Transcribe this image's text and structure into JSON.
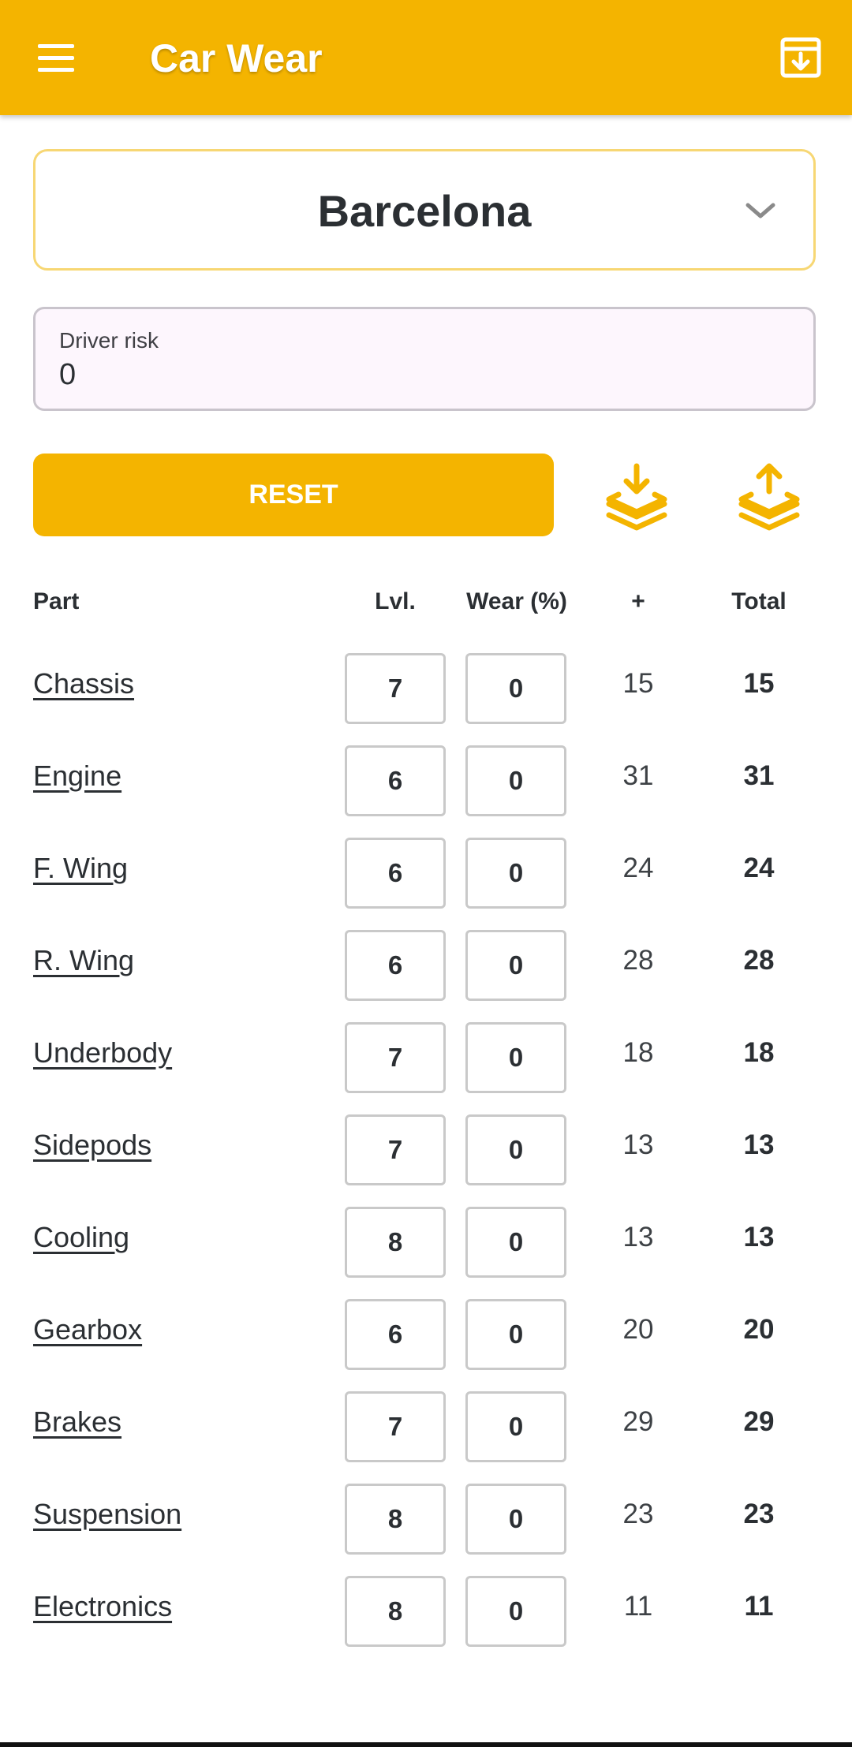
{
  "appbar": {
    "title": "Car Wear",
    "menu_icon": "hamburger-menu-icon",
    "action_icon": "archive-download-icon",
    "color": "#f4b400"
  },
  "track_selector": {
    "value": "Barcelona",
    "icon": "chevron-down-icon"
  },
  "driver_risk": {
    "label": "Driver risk",
    "value": "0"
  },
  "actions": {
    "reset_label": "RESET",
    "import_icon": "layers-download-icon",
    "export_icon": "layers-upload-icon"
  },
  "table": {
    "headers": {
      "part": "Part",
      "level": "Lvl.",
      "wear": "Wear (%)",
      "plus": "+",
      "total": "Total"
    },
    "rows": [
      {
        "part": "Chassis",
        "level": "7",
        "wear": "0",
        "plus": "15",
        "total": "15"
      },
      {
        "part": "Engine",
        "level": "6",
        "wear": "0",
        "plus": "31",
        "total": "31"
      },
      {
        "part": "F. Wing",
        "level": "6",
        "wear": "0",
        "plus": "24",
        "total": "24"
      },
      {
        "part": "R. Wing",
        "level": "6",
        "wear": "0",
        "plus": "28",
        "total": "28"
      },
      {
        "part": "Underbody",
        "level": "7",
        "wear": "0",
        "plus": "18",
        "total": "18"
      },
      {
        "part": "Sidepods",
        "level": "7",
        "wear": "0",
        "plus": "13",
        "total": "13"
      },
      {
        "part": "Cooling",
        "level": "8",
        "wear": "0",
        "plus": "13",
        "total": "13"
      },
      {
        "part": "Gearbox",
        "level": "6",
        "wear": "0",
        "plus": "20",
        "total": "20"
      },
      {
        "part": "Brakes",
        "level": "7",
        "wear": "0",
        "plus": "29",
        "total": "29"
      },
      {
        "part": "Suspension",
        "level": "8",
        "wear": "0",
        "plus": "23",
        "total": "23"
      },
      {
        "part": "Electronics",
        "level": "8",
        "wear": "0",
        "plus": "11",
        "total": "11"
      }
    ]
  }
}
